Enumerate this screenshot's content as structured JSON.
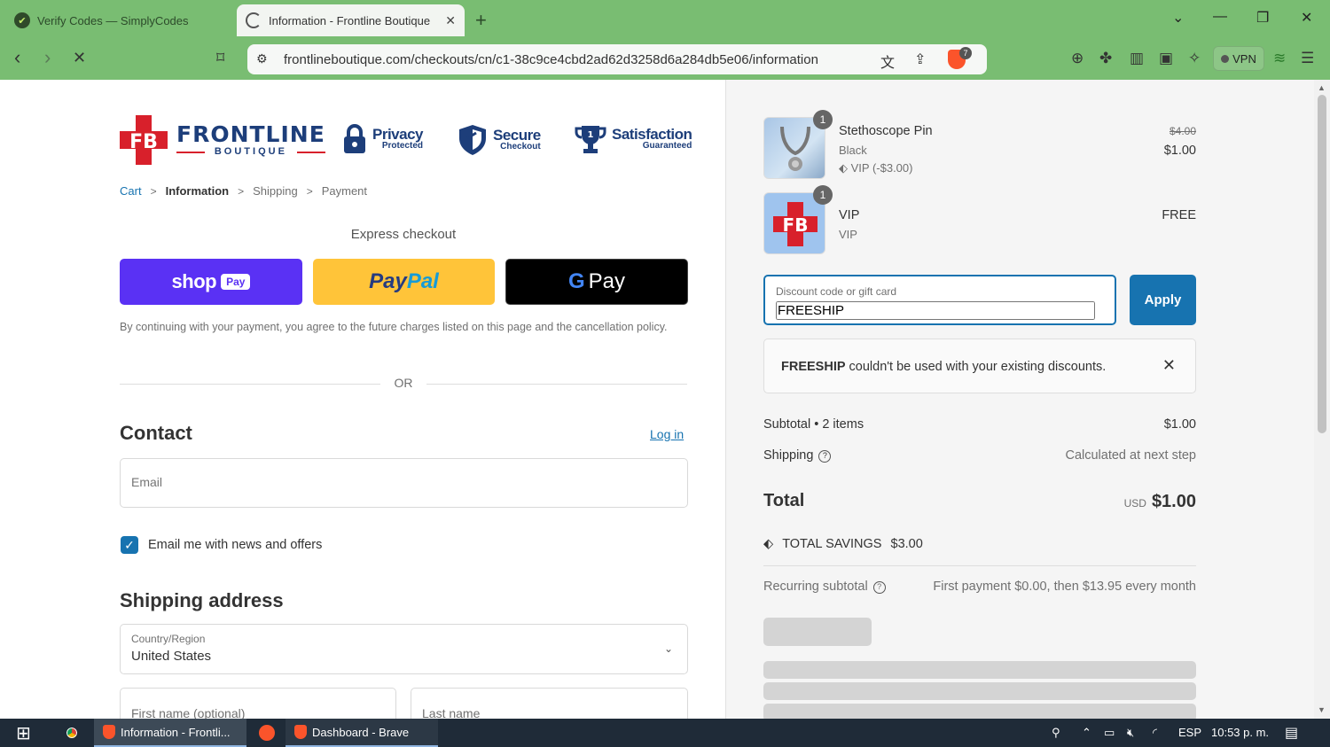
{
  "browser": {
    "tabs": [
      {
        "title": "Verify Codes — SimplyCodes",
        "active": false
      },
      {
        "title": "Information - Frontline Boutique",
        "active": true
      }
    ],
    "url": "frontlineboutique.com/checkouts/cn/c1-38c9ce4cbd2ad62d3258d6a284db5e06/information",
    "shield_count": "7",
    "vpn_label": "VPN"
  },
  "header": {
    "logo_initials": "FB",
    "logo_word": "FRONTLINE",
    "logo_sub": "BOUTIQUE",
    "badges": [
      {
        "title": "Privacy",
        "sub": "Protected"
      },
      {
        "title": "Secure",
        "sub": "Checkout"
      },
      {
        "title": "Satisfaction",
        "sub": "Guaranteed"
      }
    ]
  },
  "breadcrumb": {
    "cart": "Cart",
    "information": "Information",
    "shipping": "Shipping",
    "payment": "Payment"
  },
  "express": {
    "title": "Express checkout",
    "shop_label": "shop",
    "shop_pay_tag": "Pay",
    "paypal_a": "Pay",
    "paypal_b": "Pal",
    "gpay_g": "G",
    "gpay_label": "Pay",
    "consent": "By continuing with your payment, you agree to the future charges listed on this page and the cancellation policy.",
    "or": "OR"
  },
  "contact": {
    "title": "Contact",
    "login": "Log in",
    "email_placeholder": "Email",
    "newsletter": "Email me with news and offers"
  },
  "shipping": {
    "title": "Shipping address",
    "country_label": "Country/Region",
    "country_value": "United States",
    "first_name_placeholder": "First name (optional)",
    "last_name_placeholder": "Last name"
  },
  "summary": {
    "items": [
      {
        "qty": "1",
        "name": "Stethoscope Pin",
        "variant": "Black",
        "discount": "VIP (-$3.00)",
        "old_price": "$4.00",
        "price": "$1.00"
      },
      {
        "qty": "1",
        "name": "VIP",
        "variant": "VIP",
        "price": "FREE",
        "thumb_text": "FB"
      }
    ],
    "discount_label": "Discount code or gift card",
    "discount_value": "FREESHIP",
    "apply": "Apply",
    "error_code": "FREESHIP",
    "error_rest": " couldn't be used with your existing discounts.",
    "subtotal_label": "Subtotal • 2 items",
    "subtotal_value": "$1.00",
    "shipping_label": "Shipping",
    "shipping_value": "Calculated at next step",
    "total_label": "Total",
    "currency": "USD",
    "total_value": "$1.00",
    "savings_label": "TOTAL SAVINGS",
    "savings_value": "$3.00",
    "recurring_label": "Recurring subtotal",
    "recurring_value": "First payment $0.00, then $13.95 every month"
  },
  "taskbar": {
    "items": [
      "Information - Frontli...",
      "Dashboard - Brave"
    ],
    "lang": "ESP",
    "time": "10:53 p. m."
  },
  "colors": {
    "accent": "#1773b0",
    "shop": "#5a31f4",
    "paypal": "#ffc439",
    "brand_red": "#d8202b",
    "brand_blue": "#1d3e7a",
    "chrome": "#79bd72"
  }
}
